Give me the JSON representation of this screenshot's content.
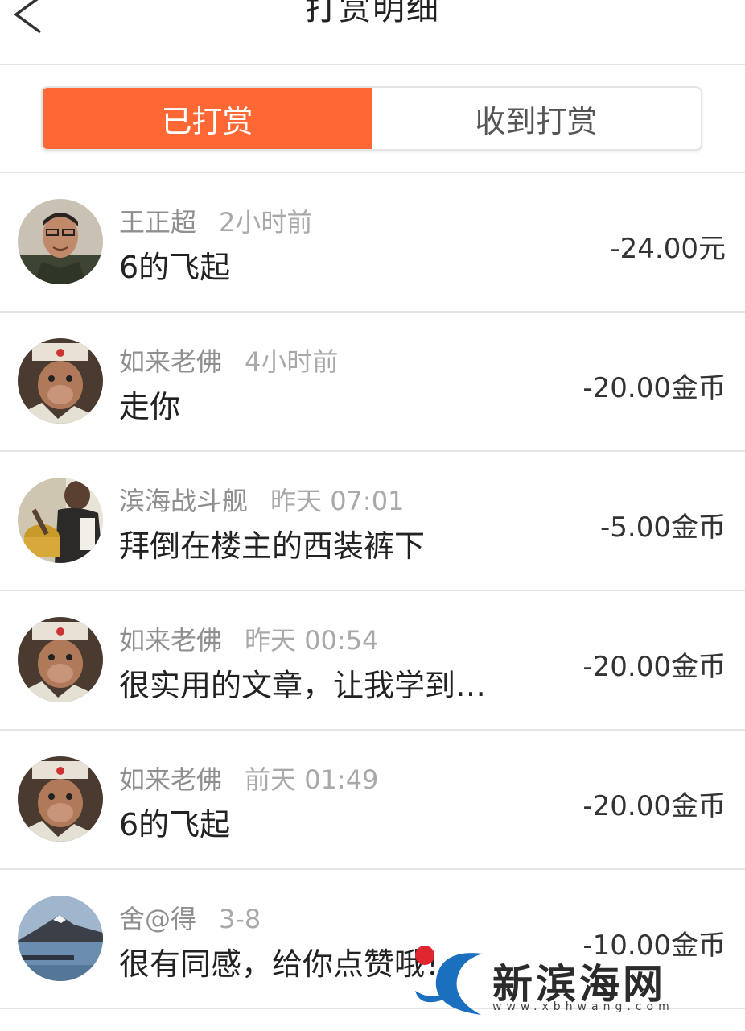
{
  "header": {
    "title": "打赏明细",
    "back_icon": "chevron-left-icon"
  },
  "tabs": [
    {
      "label": "已打赏",
      "active": true
    },
    {
      "label": "收到打赏",
      "active": false
    }
  ],
  "colors": {
    "accent": "#ff6734",
    "divider": "#e6e6e6"
  },
  "rows": [
    {
      "name": "王正超",
      "time": "2小时前",
      "message": "6的飞起",
      "amount": "-24.00元",
      "avatar": "man-portrait"
    },
    {
      "name": "如来老佛",
      "time": "4小时前",
      "message": "走你",
      "amount": "-20.00金币",
      "avatar": "monkey-king"
    },
    {
      "name": "滨海战斗舰",
      "time": "昨天 07:01",
      "message": "拜倒在楼主的西装裤下",
      "amount": "-5.00金币",
      "avatar": "person-with-drink"
    },
    {
      "name": "如来老佛",
      "time": "昨天 00:54",
      "message": "很实用的文章，让我学到…",
      "amount": "-20.00金币",
      "avatar": "monkey-king"
    },
    {
      "name": "如来老佛",
      "time": "前天 01:49",
      "message": "6的飞起",
      "amount": "-20.00金币",
      "avatar": "monkey-king"
    },
    {
      "name": "舍@得",
      "time": "3-8",
      "message": "很有同感，给你点赞哦！",
      "amount": "-10.00金币",
      "avatar": "mountain-lake"
    }
  ],
  "watermark": {
    "text": "新滨海网",
    "url": "www.xbhwang.com"
  }
}
